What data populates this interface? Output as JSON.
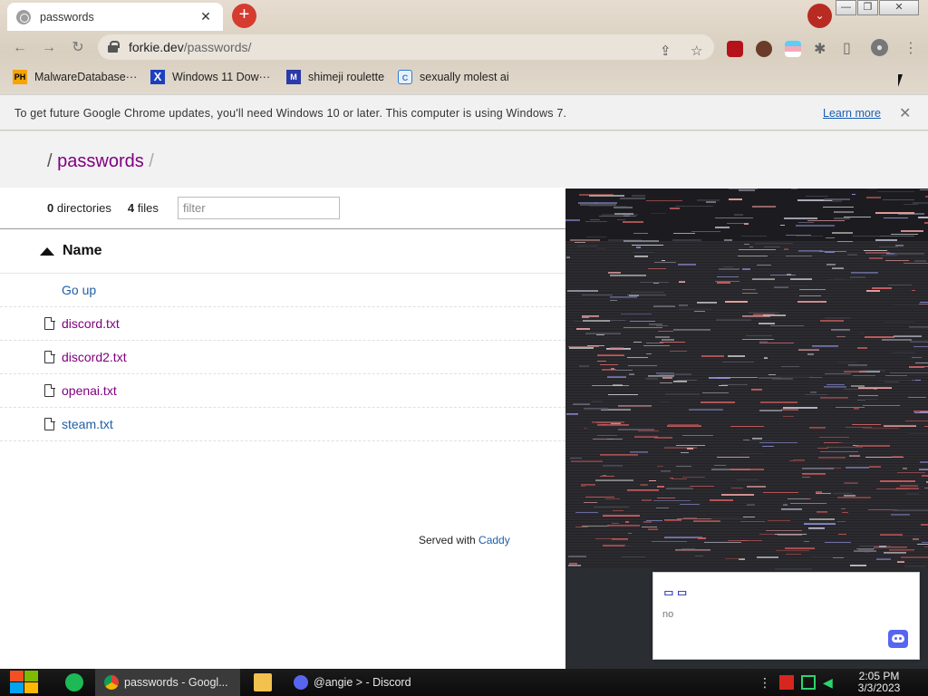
{
  "browser": {
    "tab": {
      "title": "passwords",
      "close": "✕"
    },
    "new_tab": "+",
    "tab_search": "⌄",
    "window_buttons": {
      "minimize": "—",
      "restore": "❐",
      "close": "✕"
    },
    "nav": {
      "back": "←",
      "forward": "→",
      "reload": "↻"
    },
    "address": {
      "host": "forkie.dev",
      "path": "/passwords/"
    },
    "omnibox_icons": {
      "share": "⇪",
      "bookmark": "☆"
    },
    "extensions_icon": "✱",
    "sidebar_icon": "▯",
    "profile_icon": "●",
    "menu_icon": "⋮",
    "bookmarks": [
      {
        "label": "MalwareDatabase···",
        "icon": "PH",
        "color": "#f7a400"
      },
      {
        "label": "Windows 11 Dow···",
        "icon": "X",
        "color": "#1d3fbf"
      },
      {
        "label": "shimeji roulette",
        "icon": "M",
        "color": "#2a3aa8"
      },
      {
        "label": "sexually molest ai",
        "icon": "C",
        "color": "#2b7bd6"
      }
    ],
    "infobar": {
      "message": "To get future Google Chrome updates, you'll need Windows 10 or later. This computer is using Windows 7.",
      "link": "Learn more",
      "close": "✕"
    }
  },
  "page": {
    "breadcrumb": {
      "sep1": "/",
      "dir": "passwords",
      "sep2": "/"
    },
    "summary": {
      "dir_count": "0",
      "dir_label": "directories",
      "file_count": "4",
      "file_label": "files"
    },
    "filter_placeholder": "filter",
    "column_name": "Name",
    "go_up": "Go up",
    "files": [
      {
        "name": "discord.txt",
        "visited": true
      },
      {
        "name": "discord2.txt",
        "visited": true
      },
      {
        "name": "openai.txt",
        "visited": true
      },
      {
        "name": "steam.txt",
        "visited": false
      }
    ],
    "footer": {
      "prefix": "Served with",
      "link": "Caddy"
    }
  },
  "toast": {
    "title": "ᄆᄆ",
    "body": "no"
  },
  "taskbar": {
    "items": [
      {
        "label": "passwords - Googl...",
        "active": true
      },
      {
        "label": "@angie > - Discord",
        "active": false
      }
    ],
    "clock": {
      "time": "2:05 PM",
      "date": "3/3/2023"
    }
  }
}
